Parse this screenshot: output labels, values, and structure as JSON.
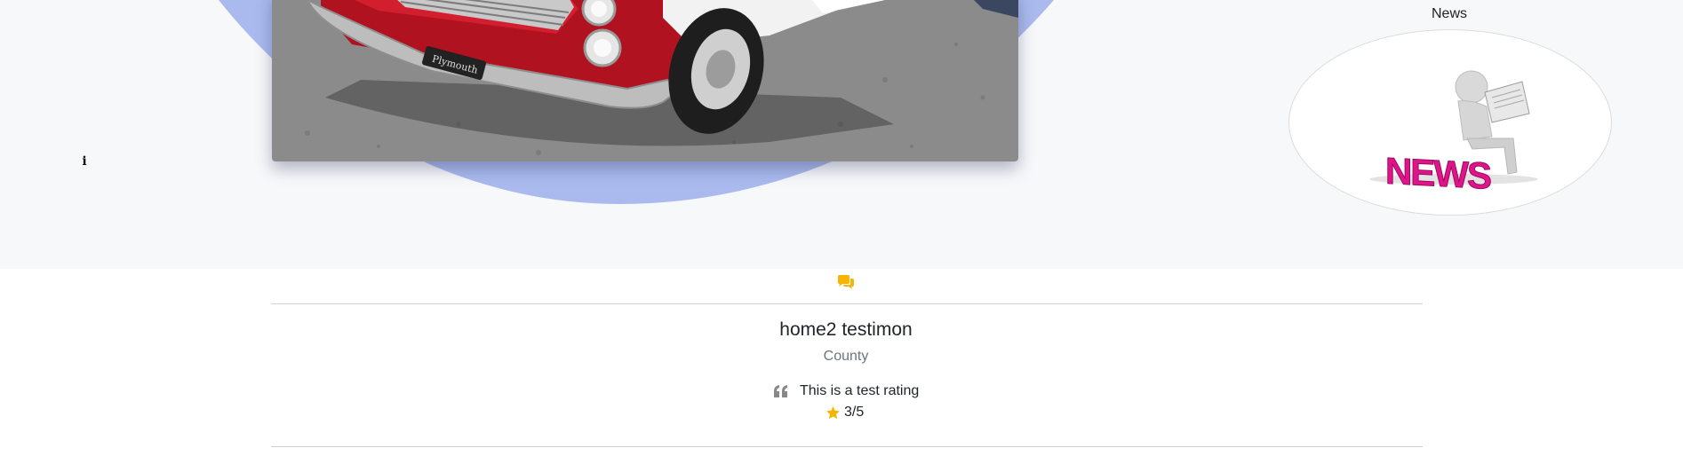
{
  "hero": {
    "info_icon": "info-icon",
    "car_image_plate": "Plymouth"
  },
  "news": {
    "label": "News",
    "illustration_text": "NEWS"
  },
  "testimonial": {
    "icon": "comments-icon",
    "name": "home2 testimon",
    "location": "County",
    "quote_icon": "quote-left-icon",
    "text": "This is a test rating",
    "star_icon": "star-icon",
    "rating": "3/5"
  },
  "colors": {
    "blob": "#aabaee",
    "accent": "#f5b500",
    "news_pink": "#e0148a",
    "muted_text": "#6c757d"
  }
}
